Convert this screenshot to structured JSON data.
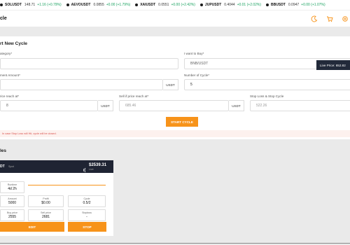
{
  "ticker": [
    {
      "symbol": "SOLUSDT",
      "price": "148.71",
      "change": "+1.16 (+0.79%)"
    },
    {
      "symbol": "AEVOUSDT",
      "price": "0.0855",
      "change": "+0.00 (+1.79%)"
    },
    {
      "symbol": "XAIUSDT",
      "price": "0.0551",
      "change": "+0.00 (+2.42%)"
    },
    {
      "symbol": "JUPUSDT",
      "price": "0.4044",
      "change": "+0.01 (+2.02%)"
    },
    {
      "symbol": "BBUSDT",
      "price": "0.0947",
      "change": "+0.00 (+1.07%)"
    }
  ],
  "header": {
    "title": "cle"
  },
  "form": {
    "title": "rt New Cycle",
    "category_label": "ategory*",
    "category_value": "",
    "want_label": "I want to Buy*",
    "want_value": "BNB/USDT",
    "tooltip": "Live Price: 652.82",
    "amount_label": "ment Amount*",
    "amount_value": "",
    "amount_suffix": "USDT",
    "cycles_label": "Number of Cycle*",
    "cycles_value": "5",
    "buy_label": "rice reach at*",
    "buy_value": "8",
    "buy_suffix": "USDT",
    "sell_label": "Sell if price reach at*",
    "sell_placeholder": "685.46",
    "sell_suffix": "USDT",
    "stop_label": "Stop Loss & Stop Cycle",
    "stop_placeholder": "522.26",
    "start_button": "START CYCLE",
    "note": "In case Stop Loss will Hit, cycle will be closed."
  },
  "cycles": {
    "title": "les",
    "card": {
      "pair": "DT",
      "type": "Spot",
      "price": "$2539.31",
      "price_sub": "Live",
      "runtime_label": "Runtime",
      "runtime_value": "4d 2h",
      "amount_label": "Amount",
      "amount_value": "5000",
      "profit_label": "Profit",
      "profit_value": "$0.00",
      "cycle_label": "Cycle",
      "cycle_value": "0.5/2",
      "buy_price_label": "Buy price",
      "buy_price_value": "2555",
      "sell_price_label": "Sell price",
      "sell_price_value": "2681",
      "stoploss_label": "Stoploss",
      "stoploss_value": "-",
      "edit_button": "EDIT",
      "stop_button": "STOP"
    }
  },
  "colors": {
    "accent": "#f7931a",
    "dark": "#1f2433",
    "positive": "#1aa260"
  },
  "icons": [
    "moon-icon",
    "cart-icon",
    "gear-icon"
  ]
}
